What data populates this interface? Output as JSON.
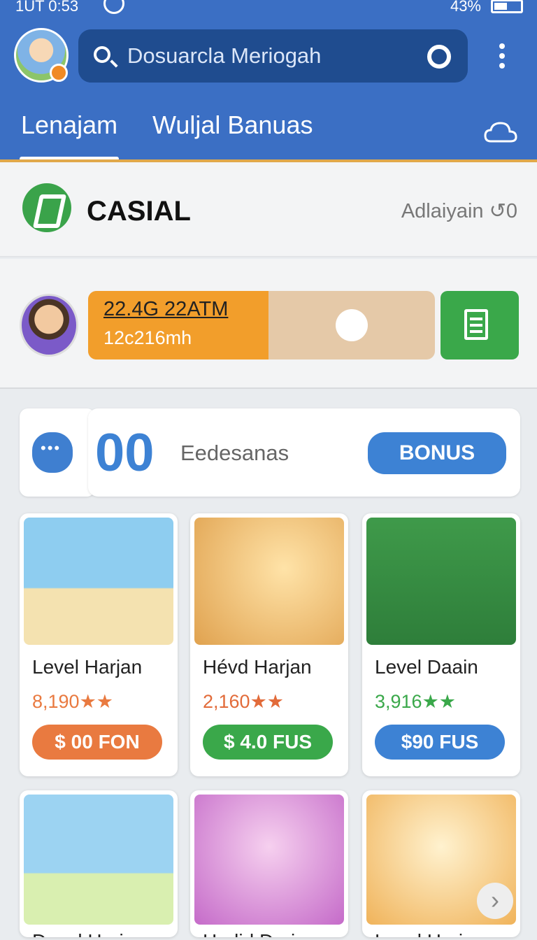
{
  "status": {
    "time": "1UT 0:53",
    "battery": "43%"
  },
  "search": {
    "placeholder": "Dosuarcla Meriogah"
  },
  "tabs": [
    {
      "label": "Lenajam"
    },
    {
      "label": "Wuljal Banuas"
    }
  ],
  "section": {
    "title": "CASIAL",
    "side": "Adlaiyain ↺0"
  },
  "progress": {
    "line1": "22.4G 22ATM",
    "line2": "12c216mh",
    "fraction": 0.52
  },
  "bonus": {
    "count": "00",
    "label": "Eedesanas",
    "button": "BONUS"
  },
  "cards": [
    {
      "name": "Level Harjan",
      "score": "8,190★★",
      "price": "$ 00 FON",
      "accent": "#e97a40"
    },
    {
      "name": "Hévd Harjan",
      "score": "2,160★★",
      "price": "$ 4.0 FUS",
      "accent": "#3aa84a"
    },
    {
      "name": "Level Daain",
      "score": "3,916★★",
      "price": "$90 FUS",
      "accent": "#3d82d4"
    }
  ],
  "cards_row2": [
    {
      "name": "Devel Harjan"
    },
    {
      "name": "Hedid Derjan"
    },
    {
      "name": "Level Harjan"
    }
  ],
  "colors": {
    "header": "#3b6fc4",
    "orange": "#f29e2b",
    "green": "#3aa84a",
    "blue": "#3d82d4"
  },
  "icons": [
    "search-icon",
    "menu-icon",
    "cloud-icon",
    "clock-icon",
    "document-icon",
    "chat-icon",
    "next-icon"
  ]
}
